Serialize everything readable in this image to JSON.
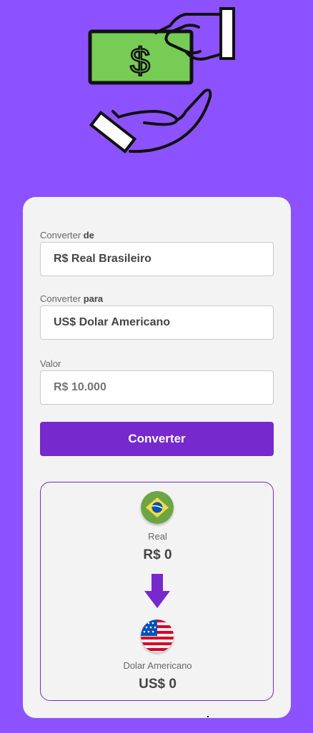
{
  "form": {
    "from_label_prefix": "Converter",
    "from_label_bold": "de",
    "from_value": "R$ Real Brasileiro",
    "to_label_prefix": "Converter",
    "to_label_bold": "para",
    "to_value": "US$ Dolar Americano",
    "amount_label": "Valor",
    "amount_placeholder": "R$ 10.000",
    "convert_button": "Converter"
  },
  "result": {
    "from_currency_name": "Real",
    "from_currency_value": "R$ 0",
    "from_flag_icon": "brazil-flag-icon",
    "arrow_icon": "arrow-down-icon",
    "to_currency_name": "Dolar Americano",
    "to_currency_value": "US$ 0",
    "to_flag_icon": "usa-flag-icon"
  },
  "colors": {
    "background": "#8c52ff",
    "accent": "#7629cc",
    "card": "#f3f3f3",
    "money_green": "#77cc55"
  },
  "hero_icon": "money-hand-exchange-icon"
}
